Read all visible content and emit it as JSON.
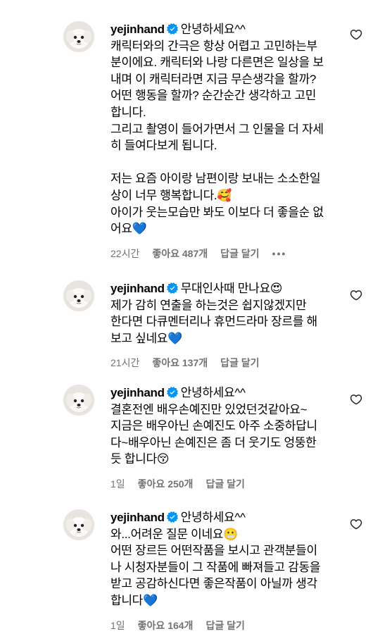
{
  "colors": {
    "verified": "#0095f6",
    "meta_text": "#737373",
    "heart_stroke": "#262626"
  },
  "comments": [
    {
      "username": "yejinhand",
      "first_line": "안녕하세요^^",
      "lines": [
        "캐릭터와의 간극은 항상 어렵고 고민하는부",
        "분이에요. 캐릭터와 나랑 다른면은 일상을 보",
        "내며 이 캐릭터라면 지금 무슨생각을 할까?",
        "어떤 행동을 할까? 순간순간 생각하고 고민",
        "합니다.",
        "그리고 촬영이 들어가면서 그 인물을 더 자세",
        "히 들여다보게 됩니다.",
        "",
        "저는 요즘 아이랑 남편이랑 보내는 소소한일",
        "상이 너무 행복합니다.🥰",
        "아이가 웃는모습만 봐도 이보다 더 좋을순 없",
        "어요💙"
      ],
      "time": "22시간",
      "likes": "좋아요 487개",
      "reply": "답글 달기",
      "more": "•••"
    },
    {
      "username": "yejinhand",
      "first_line": "무대인사때 만나요😍",
      "lines": [
        "제가 감히 연출을 하는것은 쉽지않겠지만",
        "한다면 다큐멘터리나 휴먼드라마 장르를 해",
        "보고 싶네요💙"
      ],
      "time": "21시간",
      "likes": "좋아요 137개",
      "reply": "답글 달기"
    },
    {
      "username": "yejinhand",
      "first_line": "안녕하세요^^",
      "lines": [
        "결혼전엔 배우손예진만 있었던것같아요~",
        "지금은 배우아닌 손예진도 아주 소중하답니",
        "다~배우아닌 손예진은 좀 더 웃기도 엉뚱한",
        "듯 합니다😚"
      ],
      "time": "1일",
      "likes": "좋아요 250개",
      "reply": "답글 달기"
    },
    {
      "username": "yejinhand",
      "first_line": "안녕하세요^^",
      "lines": [
        "와...어려운 질문 이네요😬",
        "어떤 장르든 어떤작품을 보시고 관객분들이",
        "나 시청자분들이 그 작품에 빠져들고 감동을",
        "받고 공감하신다면 좋은작품이 아닐까 생각",
        "합니다💙"
      ],
      "time": "1일",
      "likes": "좋아요 164개",
      "reply": "답글 달기"
    }
  ]
}
